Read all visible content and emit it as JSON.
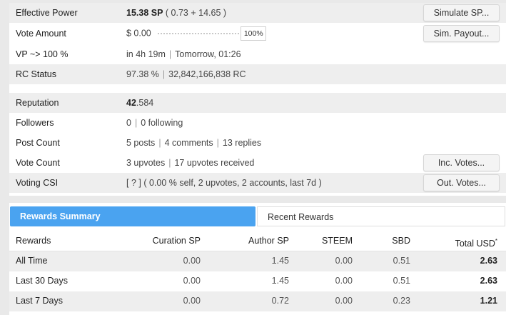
{
  "stats": {
    "effective_power": {
      "label": "Effective Power",
      "value": "15.38 SP",
      "detail": "( 0.73 + 14.65 )",
      "button": "Simulate SP..."
    },
    "vote_amount": {
      "label": "Vote Amount",
      "value": "$ 0.00",
      "percent": "100%",
      "button": "Sim. Payout..."
    },
    "vp": {
      "label": "VP ~> 100 %",
      "value": "in 4h 19m",
      "value2": "Tomorrow, 01:26"
    },
    "rc": {
      "label": "RC Status",
      "value": "97.38 %",
      "value2": "32,842,166,838 RC"
    },
    "reputation": {
      "label": "Reputation",
      "whole": "42",
      "fraction": ".584"
    },
    "followers": {
      "label": "Followers",
      "value": "0",
      "value2": "0 following"
    },
    "post_count": {
      "label": "Post Count",
      "value": "5 posts",
      "value2": "4 comments",
      "value3": "13 replies"
    },
    "vote_count": {
      "label": "Vote Count",
      "value": "3 upvotes",
      "value2": "17 upvotes received",
      "button": "Inc. Votes..."
    },
    "voting_csi": {
      "label": "Voting CSI",
      "value": "[ ? ] ( 0.00 % self, 2 upvotes, 2 accounts, last 7d )",
      "button": "Out. Votes..."
    },
    "separator": "|"
  },
  "rewards": {
    "tabs": {
      "summary": "Rewards Summary",
      "recent": "Recent Rewards"
    },
    "headers": [
      "Rewards",
      "Curation SP",
      "Author SP",
      "STEEM",
      "SBD",
      "Total USD"
    ],
    "total_usd_marker": "*",
    "rows": [
      [
        "All Time",
        "0.00",
        "1.45",
        "0.00",
        "0.51",
        "2.63"
      ],
      [
        "Last 30 Days",
        "0.00",
        "1.45",
        "0.00",
        "0.51",
        "2.63"
      ],
      [
        "Last 7 Days",
        "0.00",
        "0.72",
        "0.00",
        "0.23",
        "1.21"
      ]
    ]
  },
  "colors": {
    "accent_tab": "#4aa3f0",
    "row_alt": "#eeeeee",
    "page_bg": "#e9e9e9"
  }
}
